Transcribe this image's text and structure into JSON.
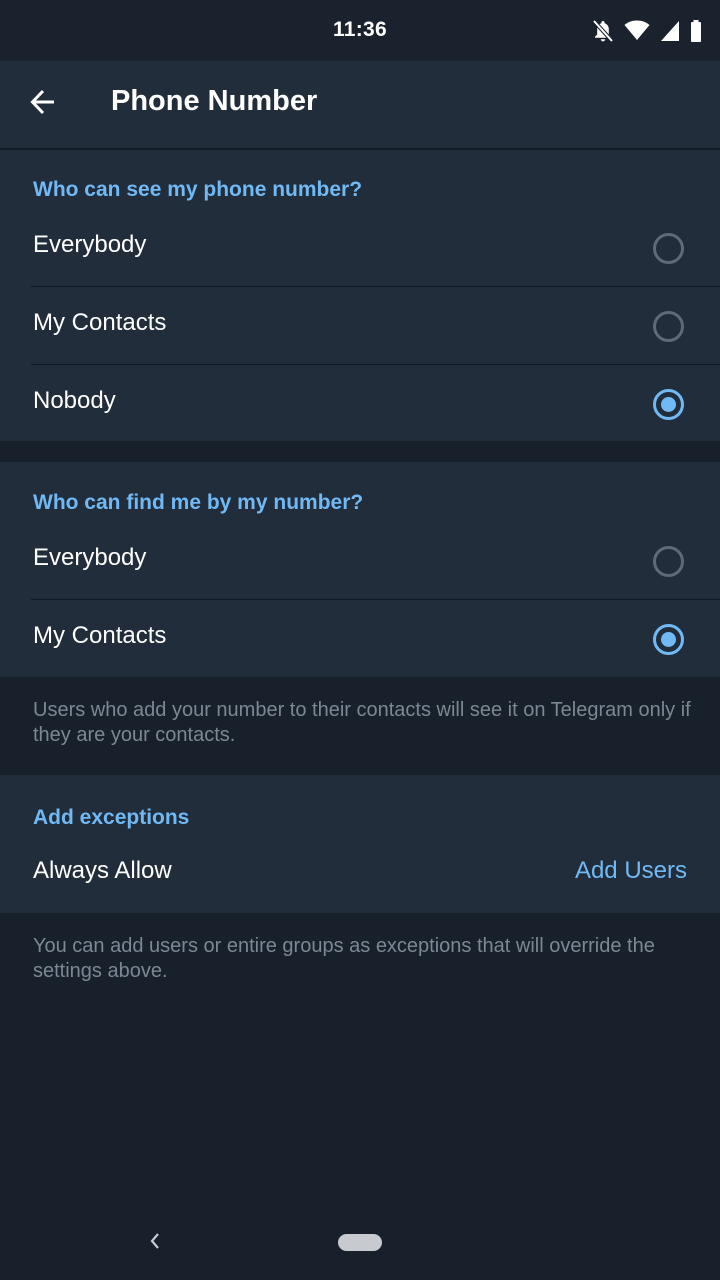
{
  "status_bar": {
    "time": "11:36",
    "icons": [
      "notifications-off-icon",
      "wifi-icon",
      "cell-signal-icon",
      "battery-icon"
    ]
  },
  "app_bar": {
    "title": "Phone Number",
    "back_icon": "arrow-left-icon"
  },
  "see_number": {
    "header": "Who can see my phone number?",
    "options": [
      {
        "label": "Everybody",
        "selected": false
      },
      {
        "label": "My Contacts",
        "selected": false
      },
      {
        "label": "Nobody",
        "selected": true
      }
    ]
  },
  "find_number": {
    "header": "Who can find me by my number?",
    "options": [
      {
        "label": "Everybody",
        "selected": false
      },
      {
        "label": "My Contacts",
        "selected": true
      }
    ],
    "info": "Users who add your number to their contacts will see it on Telegram only if they are your contacts."
  },
  "exceptions": {
    "header": "Add exceptions",
    "row_label": "Always Allow",
    "action": "Add Users",
    "info": "You can add users or entire groups as exceptions that will override the settings above."
  },
  "colors": {
    "accent": "#71b9f4",
    "background": "#18202b",
    "surface": "#212d3b"
  }
}
